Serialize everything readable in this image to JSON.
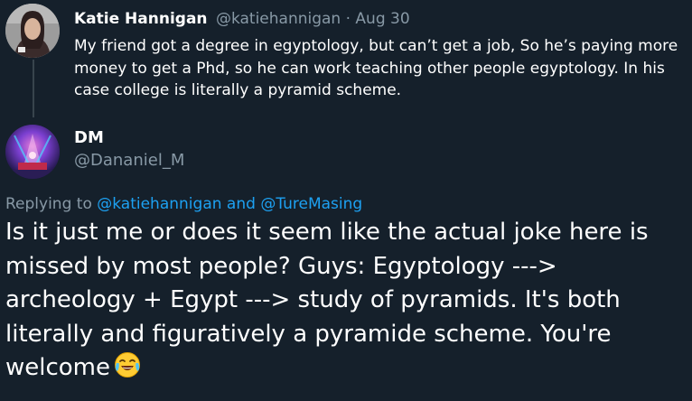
{
  "parent_tweet": {
    "author_name": "Katie Hannigan",
    "author_handle": "@katiehannigan",
    "separator": "·",
    "date": "Aug 30",
    "text": "My friend got a degree in egyptology, but can’t get a job, So he’s paying more money to get a Phd, so he can work teaching other people egyptology. In his case college is literally a pyramid scheme."
  },
  "reply_tweet": {
    "author_name": "DM",
    "author_handle": "@Dananiel_M",
    "replying_prefix": "Replying to",
    "replying_user_1": "@katiehannigan",
    "replying_and": "and",
    "replying_user_2": "@TureMasing",
    "text": "Is it just me or does it seem like the actual joke here is missed by most people? Guys: Egyptology ---> archeology + Egypt ---> study of pyramids. It's both literally and figuratively a pyramide scheme. You're welcome",
    "emoji": "face-with-tears-of-joy-icon"
  },
  "colors": {
    "background": "#15202b",
    "primary_text": "#ffffff",
    "secondary_text": "#8899a6",
    "link": "#1da1f2",
    "thread_line": "#38444d"
  }
}
